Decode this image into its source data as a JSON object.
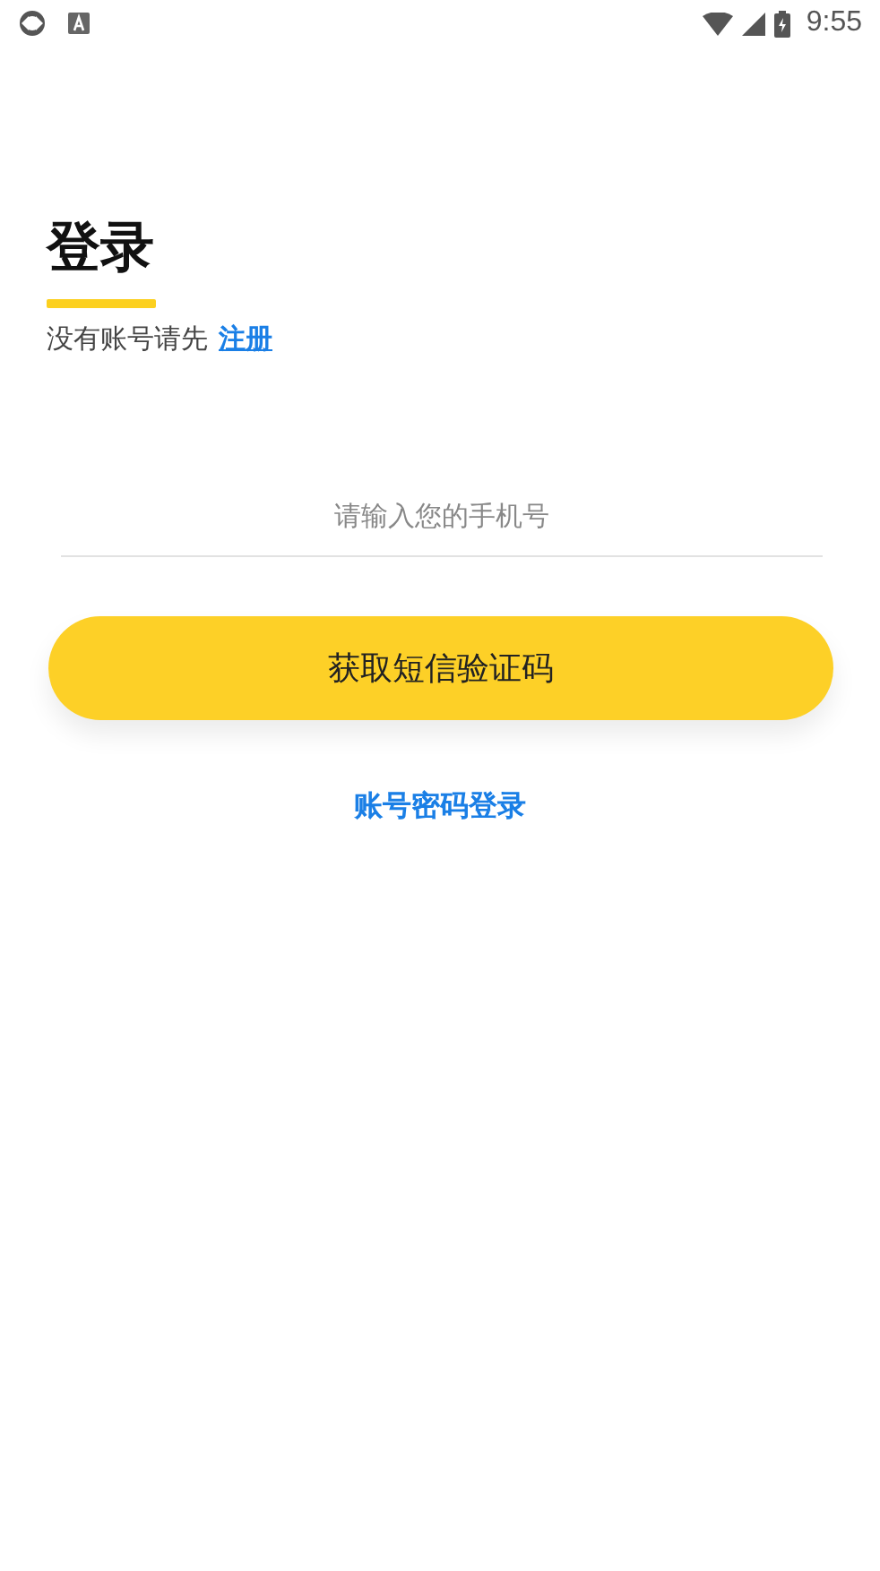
{
  "status_bar": {
    "time": "9:55"
  },
  "title": "登录",
  "register_prompt": {
    "text": "没有账号请先",
    "link": "注册"
  },
  "phone_field": {
    "placeholder": "请输入您的手机号"
  },
  "primary_button": "获取短信验证码",
  "alt_login_link": "账号密码登录"
}
